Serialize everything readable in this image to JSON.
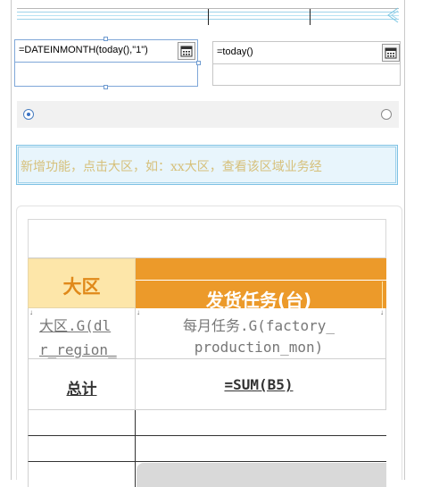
{
  "date_fields": {
    "start_formula": "=DATEINMONTH(today(),\"1\")",
    "end_formula": "=today()"
  },
  "notice": {
    "text": "新增功能，点击大区，如：xx大区，查看该区域业务经"
  },
  "table": {
    "header_region": "大区",
    "header_task": "发货任务(台)",
    "row_region_field": "大区.G(dlr_region_",
    "row_region_field_line1": "大区.G(dl",
    "row_region_field_line2": "r_region_",
    "row_task_field_line1": "每月任务.G(factory_",
    "row_task_field_line2": "production_mon)",
    "total_label": "总计",
    "total_formula": "=SUM(B5)"
  },
  "colors": {
    "header_region_bg": "#fde6a9",
    "header_task_bg": "#ec9a2a",
    "header_region_text": "#e0891a",
    "notice_text": "#d6c07a",
    "selection": "#7fa7d8"
  },
  "icons": [
    "calendar-icon",
    "radio-selected-icon",
    "radio-unselected-icon"
  ]
}
